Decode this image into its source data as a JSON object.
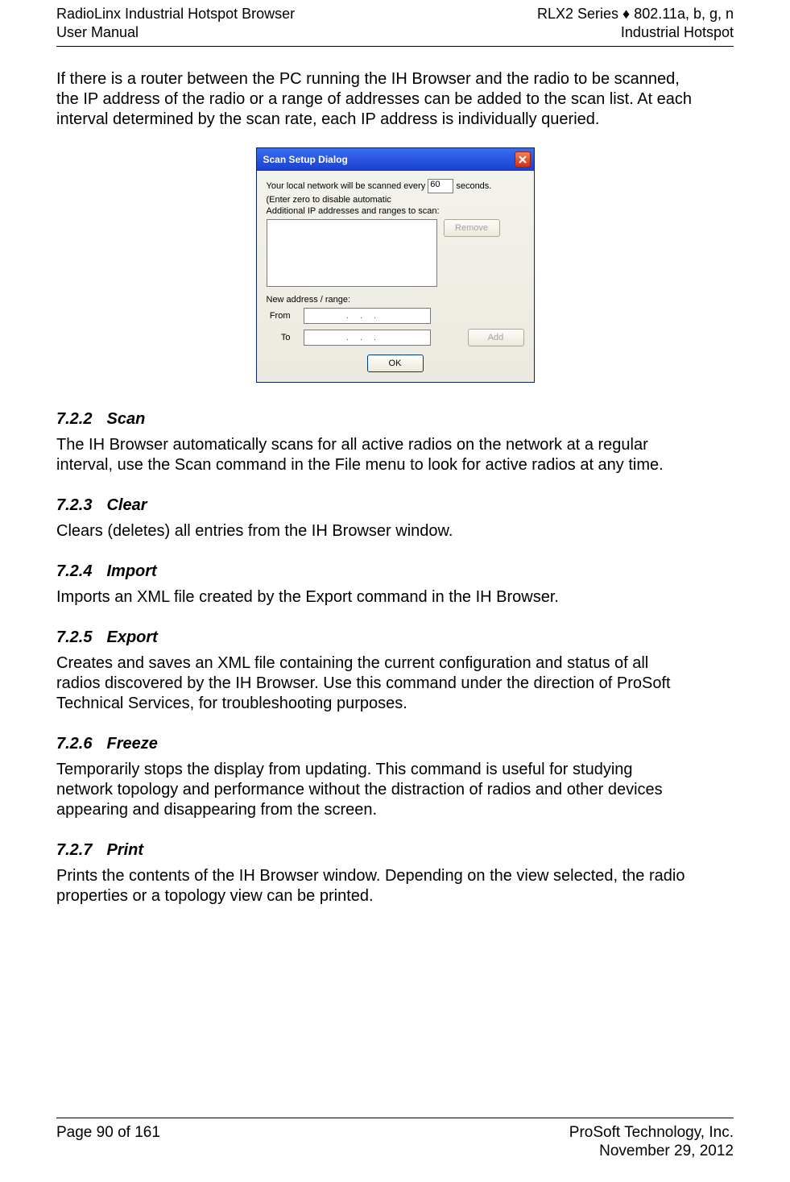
{
  "header": {
    "left_line1": "RadioLinx Industrial Hotspot Browser",
    "left_line2": "User Manual",
    "right_line1": "RLX2 Series ♦ 802.11a, b, g, n",
    "right_line2": "Industrial Hotspot"
  },
  "intro_para": "If there is a router between the PC running the IH Browser and the radio to be scanned, the IP address of the radio or a range of addresses can be added to the scan list. At each interval determined by the scan rate, each IP address is individually queried.",
  "dialog": {
    "title": "Scan Setup Dialog",
    "line1_a": "Your local network will be scanned every",
    "line1_b": "seconds.",
    "seconds_value": "60",
    "line2": "(Enter zero to disable automatic",
    "line3": "Additional IP addresses and ranges to scan:",
    "remove_btn": "Remove",
    "new_addr_label": "New address / range:",
    "from_label": "From",
    "to_label": "To",
    "add_btn": "Add",
    "ok_btn": "OK",
    "ip_dots": "..."
  },
  "sections": [
    {
      "num": "7.2.2",
      "title": "Scan",
      "body": "The IH Browser automatically scans for all active radios on the network at a regular interval, use the Scan command in the File menu to look for active radios at any time."
    },
    {
      "num": "7.2.3",
      "title": "Clear",
      "body": "Clears (deletes) all entries from the IH Browser window."
    },
    {
      "num": "7.2.4",
      "title": "Import",
      "body": "Imports an XML file created by the Export command in the IH Browser."
    },
    {
      "num": "7.2.5",
      "title": "Export",
      "body": "Creates and saves an XML file containing the current configuration and status of all radios discovered by the IH Browser. Use this command under the direction of ProSoft Technical Services, for troubleshooting purposes."
    },
    {
      "num": "7.2.6",
      "title": "Freeze",
      "body": "Temporarily stops the display from updating. This command is useful for studying network topology and performance without the distraction of radios and other devices appearing and disappearing from the screen."
    },
    {
      "num": "7.2.7",
      "title": "Print",
      "body": "Prints the contents of the IH Browser window. Depending on the view selected, the radio properties or a topology view can be printed."
    }
  ],
  "footer": {
    "left": "Page 90 of 161",
    "right_line1": "ProSoft Technology, Inc.",
    "right_line2": "November 29, 2012"
  }
}
